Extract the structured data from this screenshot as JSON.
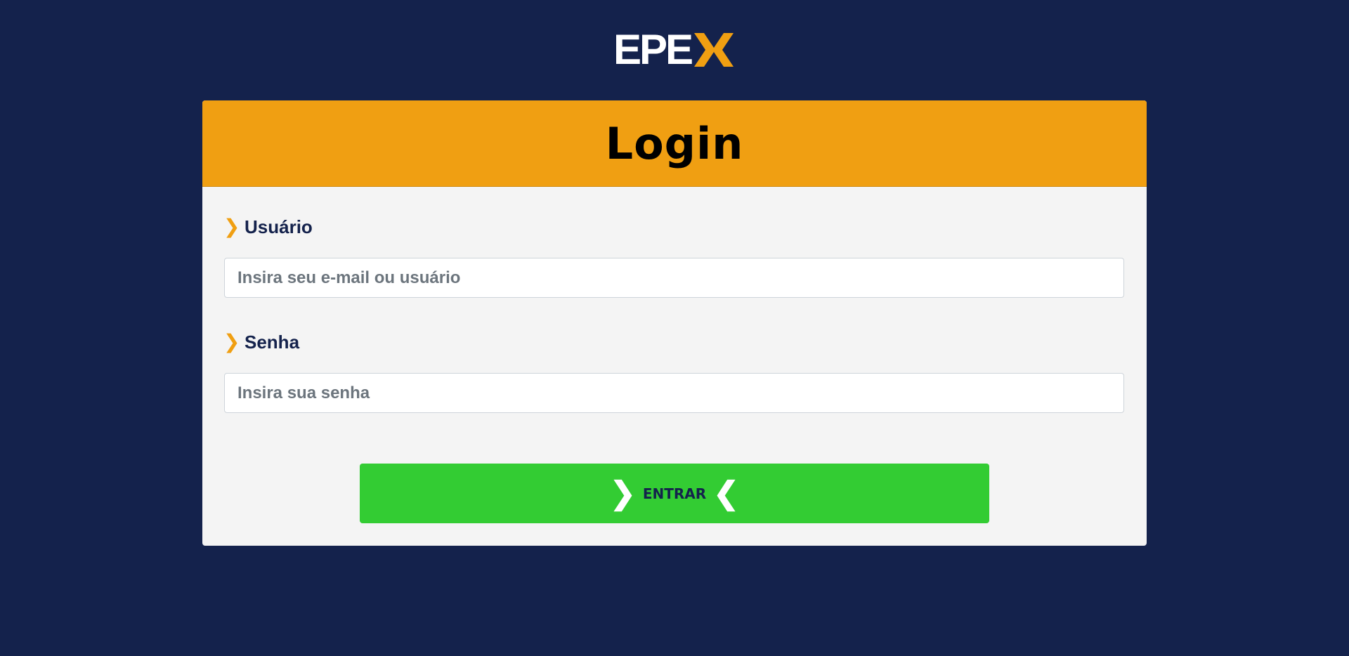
{
  "brand": {
    "logo_text": "EPE",
    "logo_icon": "x-chevron-logo",
    "logo_accent_color": "#f09f12"
  },
  "login": {
    "title": "Login",
    "username": {
      "label": "Usuário",
      "placeholder": "Insira seu e-mail ou usuário",
      "value": ""
    },
    "password": {
      "label": "Senha",
      "placeholder": "Insira sua senha",
      "value": ""
    },
    "submit_label": "ENTRAR"
  },
  "icons": {
    "label_chevron": "❯",
    "button_left_chevron": "❯",
    "button_right_chevron": "❮"
  },
  "colors": {
    "background": "#14224c",
    "header": "#f09f12",
    "card": "#f4f4f4",
    "button": "#33cc33"
  }
}
